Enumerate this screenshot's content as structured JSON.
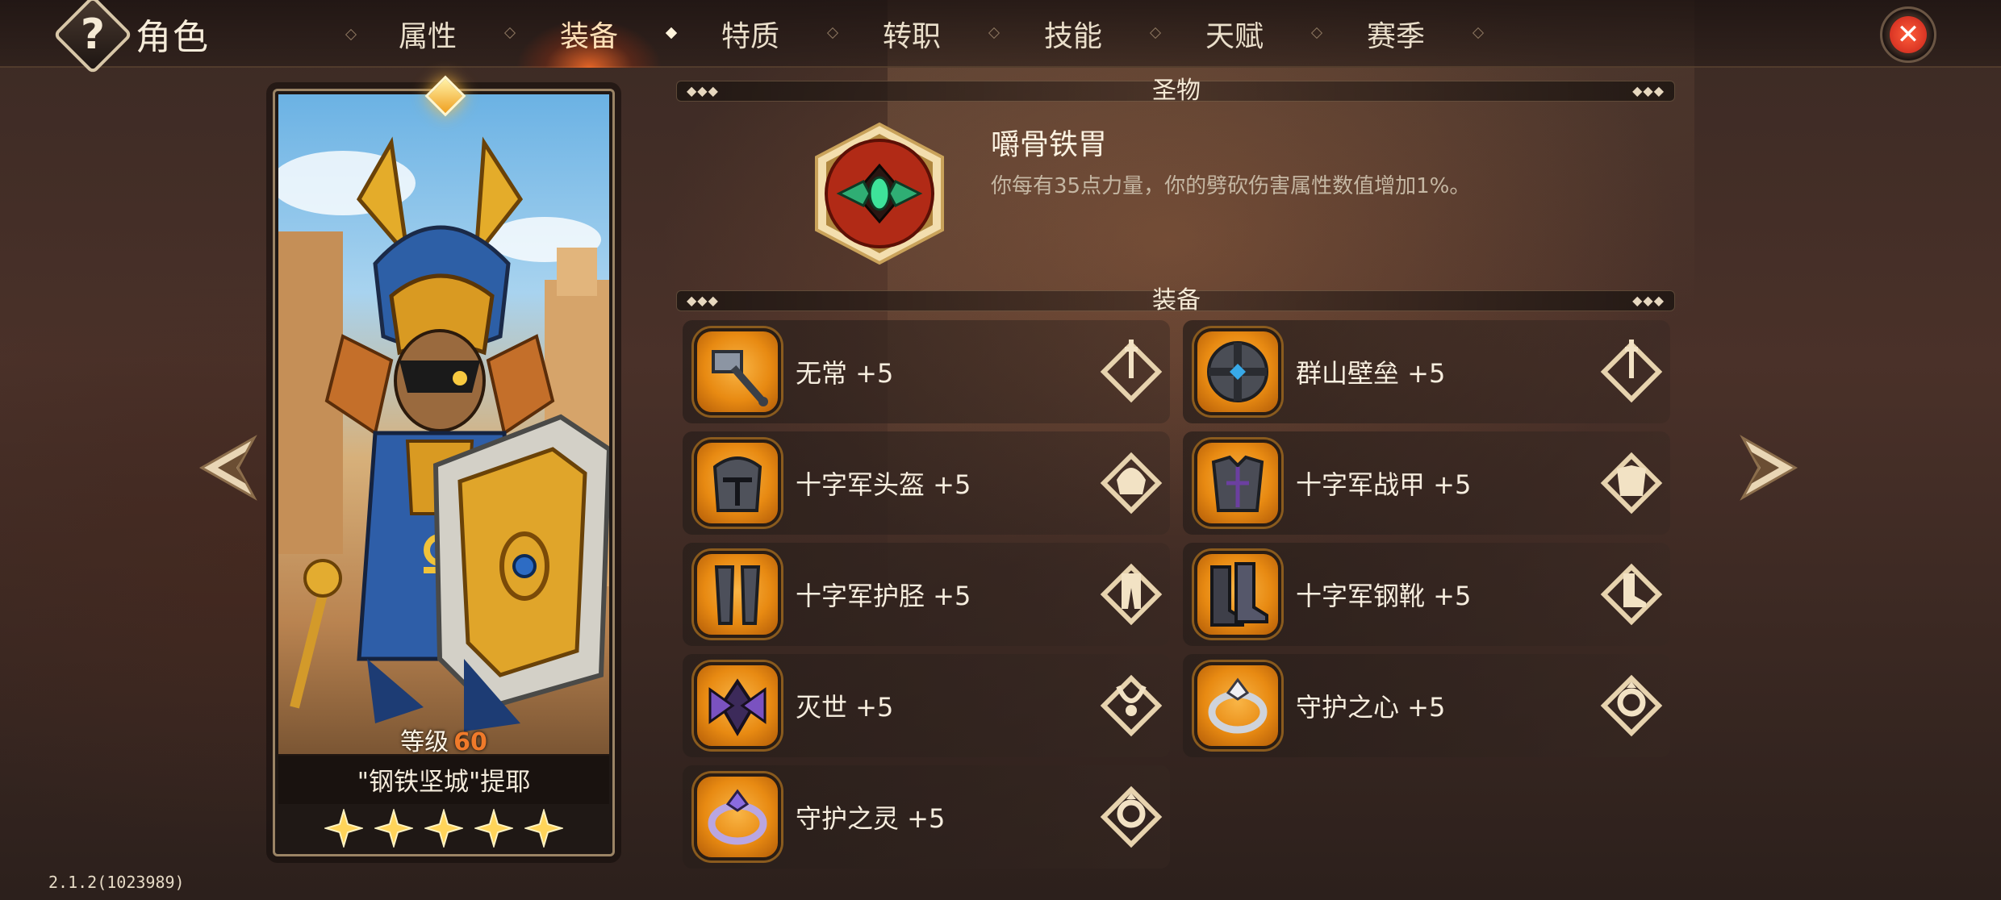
{
  "header": {
    "help_glyph": "?",
    "title": "角色",
    "tabs": [
      {
        "label": "属性",
        "active": false
      },
      {
        "label": "装备",
        "active": true
      },
      {
        "label": "特质",
        "active": false
      },
      {
        "label": "转职",
        "active": false
      },
      {
        "label": "技能",
        "active": false
      },
      {
        "label": "天赋",
        "active": false
      },
      {
        "label": "赛季",
        "active": false
      }
    ],
    "close_glyph": "✕"
  },
  "hero": {
    "level_label": "等级",
    "level_value": "60",
    "name": "\"钢铁坚城\"提耶",
    "stars": 5
  },
  "relic_section": {
    "title": "圣物",
    "relic_name": "嚼骨铁胃",
    "relic_desc": "你每有35点力量，你的劈砍伤害属性数值增加1%。"
  },
  "equipment_section": {
    "title": "装备",
    "items": [
      {
        "name": "无常 +5",
        "icon": "hammer-icon",
        "slot": "weapon-slot-icon"
      },
      {
        "name": "群山壁垒 +5",
        "icon": "shield-icon",
        "slot": "offhand-slot-icon"
      },
      {
        "name": "十字军头盔 +5",
        "icon": "helmet-icon",
        "slot": "helmet-slot-icon"
      },
      {
        "name": "十字军战甲 +5",
        "icon": "armor-icon",
        "slot": "armor-slot-icon"
      },
      {
        "name": "十字军护胫 +5",
        "icon": "greaves-icon",
        "slot": "legs-slot-icon"
      },
      {
        "name": "十字军钢靴 +5",
        "icon": "boots-icon",
        "slot": "boots-slot-icon"
      },
      {
        "name": "灭世 +5",
        "icon": "amulet-icon",
        "slot": "necklace-slot-icon"
      },
      {
        "name": "守护之心 +5",
        "icon": "ring-icon",
        "slot": "ring-slot-icon"
      },
      {
        "name": "守护之灵 +5",
        "icon": "ring-icon",
        "slot": "ring-slot-icon"
      }
    ]
  },
  "version": "2.1.2(1023989)",
  "colors": {
    "accent_orange": "#e88a12",
    "tab_active_glow": "#ff6e28",
    "level_value": "#f07a2a",
    "close_red": "#d8281c"
  }
}
